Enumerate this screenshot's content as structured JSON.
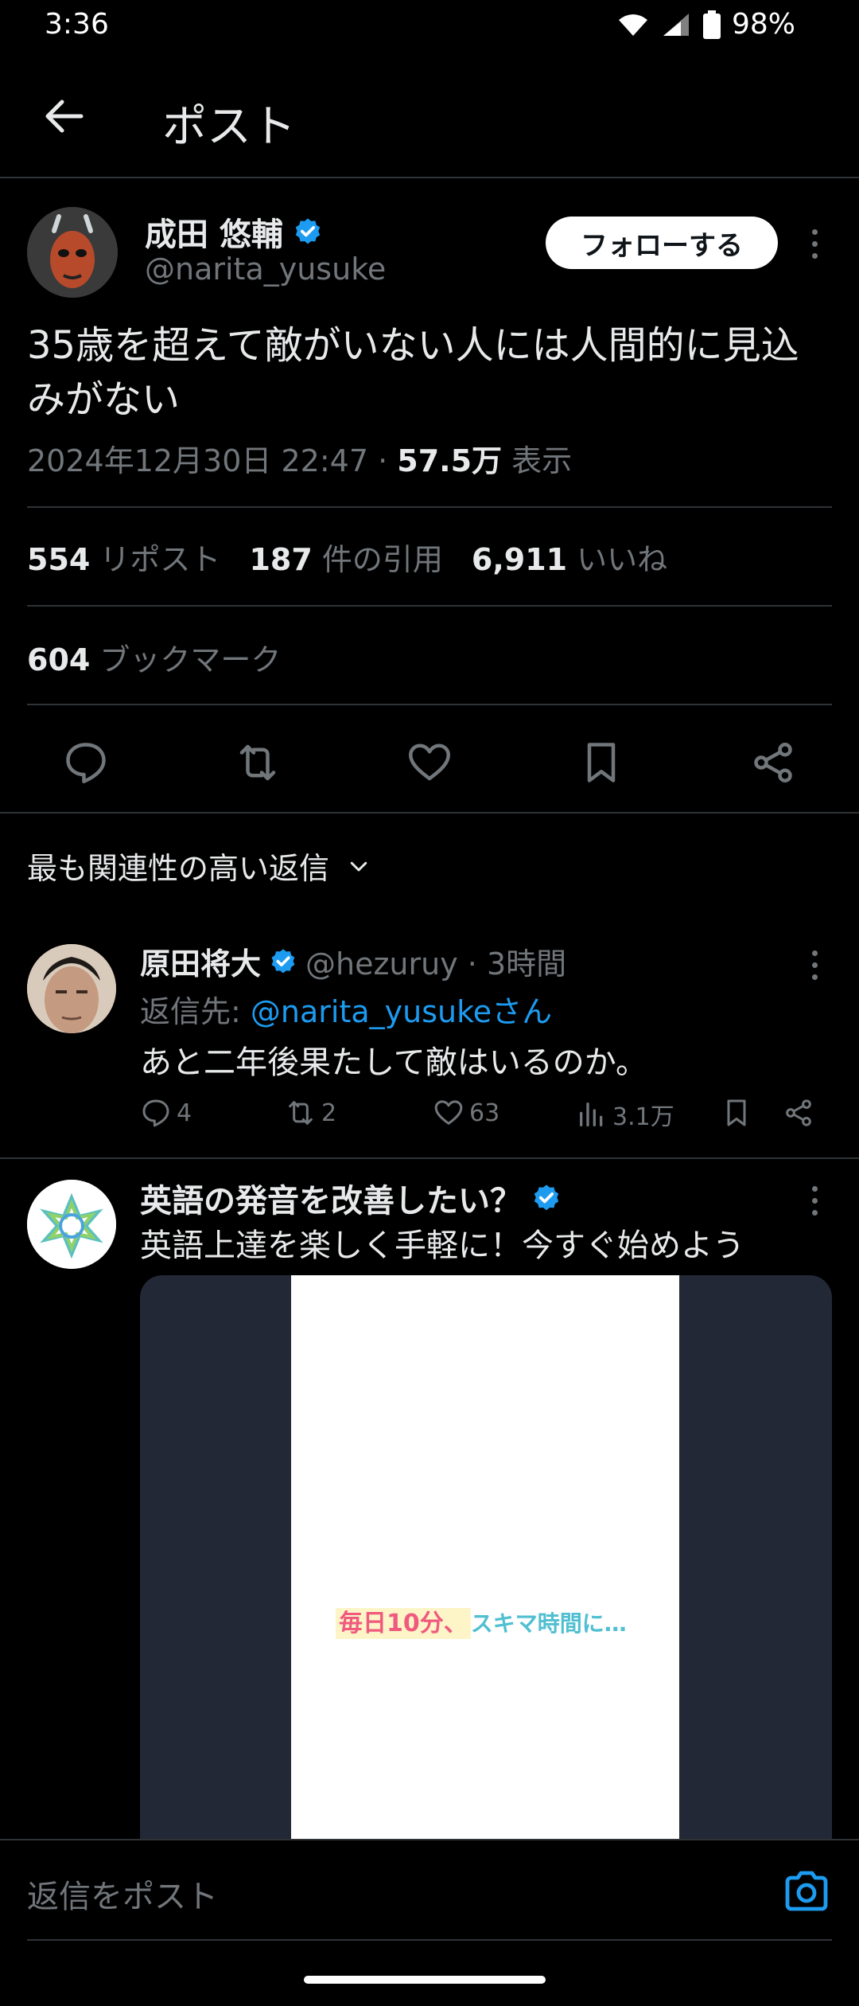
{
  "status_bar": {
    "time": "3:36",
    "battery": "98%"
  },
  "header": {
    "title": "ポスト"
  },
  "post": {
    "author_name": "成田 悠輔",
    "author_handle": "@narita_yusuke",
    "follow_label": "フォローする",
    "text": "35歳を超えて敵がいない人には人間的に見込みがない",
    "timestamp": "2024年12月30日 22:47 · ",
    "views_count": "57.5万",
    "views_label": " 表示",
    "reposts_count": "554",
    "reposts_label": "リポスト",
    "quotes_count": "187",
    "quotes_label": "件の引用",
    "likes_count": "6,911",
    "likes_label": "いいね",
    "bookmarks_count": "604",
    "bookmarks_label": "ブックマーク"
  },
  "sort": {
    "label": "最も関連性の高い返信"
  },
  "reply": {
    "author_name": "原田将大",
    "author_handle": "@hezuruy · 3時間",
    "reply_to_prefix": "返信先: ",
    "reply_to_handle": "@narita_yusukeさん",
    "text": "あと二年後果たして敵はいるのか。",
    "replies": "4",
    "reposts": "2",
    "likes": "63",
    "views": "3.1万"
  },
  "ad": {
    "title": "英語の発音を改善したい？",
    "subtitle": "英語上達を楽しく手軽に！今すぐ始めよう",
    "caption_highlight": "毎日10分、",
    "caption_rest": "スキマ時間に…"
  },
  "composer": {
    "placeholder": "返信をポスト"
  },
  "colors": {
    "accent": "#1d9bf0",
    "background": "#000000",
    "muted": "#71767b"
  }
}
